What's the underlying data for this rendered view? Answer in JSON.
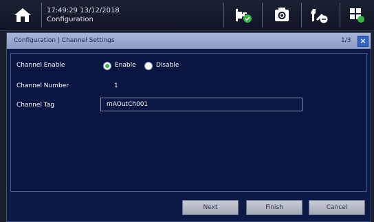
{
  "topbar": {
    "time_date": "17:49:29  13/12/2018",
    "section": "Configuration",
    "icons": [
      "home-icon",
      "plug-status-icon",
      "camera-icon",
      "tools-icon",
      "grid-settings-icon"
    ]
  },
  "dialog": {
    "title": "Configuration | Channel Settings",
    "page": "1/3",
    "close_label": "×"
  },
  "form": {
    "channel_enable_label": "Channel Enable",
    "enable_option": "Enable",
    "disable_option": "Disable",
    "selected": "Enable",
    "channel_number_label": "Channel Number",
    "channel_number_value": "1",
    "channel_tag_label": "Channel Tag",
    "channel_tag_value": "mAOutCh001"
  },
  "buttons": {
    "next": "Next",
    "finish": "Finish",
    "cancel": "Cancel"
  },
  "colors": {
    "dialog_bg": "#0d1a47",
    "header_bg": "#9aa8d0",
    "accent_green": "#3ab44a"
  }
}
